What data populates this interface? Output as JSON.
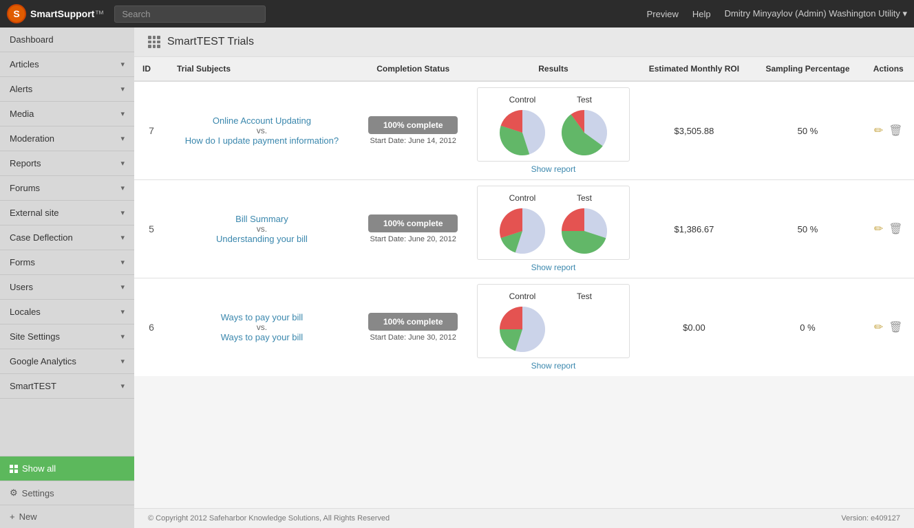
{
  "app": {
    "name": "SmartSupport",
    "logo_letter": "S"
  },
  "topnav": {
    "search_placeholder": "Search",
    "preview": "Preview",
    "help": "Help",
    "user": "Dmitry Minyaylov (Admin) Washington Utility"
  },
  "sidebar": {
    "items": [
      {
        "id": "dashboard",
        "label": "Dashboard",
        "has_arrow": false
      },
      {
        "id": "articles",
        "label": "Articles",
        "has_arrow": true
      },
      {
        "id": "alerts",
        "label": "Alerts",
        "has_arrow": true
      },
      {
        "id": "media",
        "label": "Media",
        "has_arrow": true
      },
      {
        "id": "moderation",
        "label": "Moderation",
        "has_arrow": true
      },
      {
        "id": "reports",
        "label": "Reports",
        "has_arrow": true
      },
      {
        "id": "forums",
        "label": "Forums",
        "has_arrow": true
      },
      {
        "id": "external-site",
        "label": "External site",
        "has_arrow": true
      },
      {
        "id": "case-deflection",
        "label": "Case Deflection",
        "has_arrow": true
      },
      {
        "id": "forms",
        "label": "Forms",
        "has_arrow": true
      },
      {
        "id": "users",
        "label": "Users",
        "has_arrow": true
      },
      {
        "id": "locales",
        "label": "Locales",
        "has_arrow": true
      },
      {
        "id": "site-settings",
        "label": "Site Settings",
        "has_arrow": true
      },
      {
        "id": "google-analytics",
        "label": "Google Analytics",
        "has_arrow": true
      },
      {
        "id": "smarttest",
        "label": "SmartTEST",
        "has_arrow": true
      }
    ],
    "show_all": "Show all",
    "settings": "Settings",
    "new": "New"
  },
  "page": {
    "title": "SmartTEST Trials"
  },
  "table": {
    "headers": {
      "id": "ID",
      "trial_subjects": "Trial Subjects",
      "completion_status": "Completion Status",
      "results": "Results",
      "estimated_monthly_roi": "Estimated Monthly ROI",
      "sampling_percentage": "Sampling Percentage",
      "actions": "Actions"
    },
    "rows": [
      {
        "id": 7,
        "subject_a": "Online Account Updating",
        "vs": "vs.",
        "subject_b": "How do I update payment information?",
        "status": "100% complete",
        "start_date": "Start Date: June 14, 2012",
        "control_chart": {
          "green": 0.35,
          "red": 0.2,
          "gray": 0.45
        },
        "test_chart": {
          "green": 0.55,
          "red": 0.1,
          "gray": 0.35
        },
        "show_report": "Show report",
        "roi": "$3,505.88",
        "roi_negative": false,
        "sampling": "50 %"
      },
      {
        "id": 5,
        "subject_a": "Bill Summary",
        "vs": "vs.",
        "subject_b": "Understanding your bill",
        "status": "100% complete",
        "start_date": "Start Date: June 20, 2012",
        "control_chart": {
          "green": 0.15,
          "red": 0.3,
          "gray": 0.55
        },
        "test_chart": {
          "green": 0.45,
          "red": 0.25,
          "gray": 0.3
        },
        "show_report": "Show report",
        "roi": "$1,386.67",
        "roi_negative": false,
        "sampling": "50 %"
      },
      {
        "id": 6,
        "subject_a": "Ways to pay your bill",
        "vs": "vs.",
        "subject_b": "Ways to pay your bill",
        "status": "100% complete",
        "start_date": "Start Date: June 30, 2012",
        "control_chart": {
          "green": 0.2,
          "red": 0.25,
          "gray": 0.55
        },
        "test_chart": null,
        "show_report": "Show report",
        "roi": "$0.00",
        "roi_negative": false,
        "sampling": "0 %"
      }
    ]
  },
  "footer": {
    "copyright": "© Copyright 2012 Safeharbor Knowledge Solutions, All Rights Reserved",
    "version": "Version: e409127"
  }
}
